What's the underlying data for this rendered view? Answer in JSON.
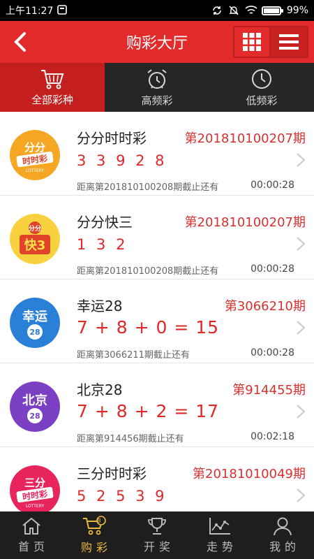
{
  "status_bar": {
    "time": "上午11:27",
    "battery": "99%",
    "battery_level": 0.99
  },
  "header": {
    "title": "购彩大厅",
    "icons": [
      "back-icon",
      "grid-icon",
      "menu-icon"
    ]
  },
  "tabs": [
    {
      "label": "全部彩种",
      "icon": "basket-icon",
      "active": true
    },
    {
      "label": "高频彩",
      "icon": "alarm-clock-icon",
      "active": false
    },
    {
      "label": "低频彩",
      "icon": "clock-icon",
      "active": false
    }
  ],
  "lotteries": [
    {
      "name": "分分时时彩",
      "period": "第201810100207期",
      "numbers": "3 3 9 2 8",
      "deadline": "距离第201810100208期截止还有",
      "countdown": "00:00:28",
      "logo": {
        "line1": "分分",
        "line2": "时时彩",
        "sub": "LOTTERY",
        "color": "#f5a623"
      }
    },
    {
      "name": "分分快三",
      "period": "第201810100207期",
      "numbers": "1 3 2",
      "deadline": "距离第201810100208期截止还有",
      "countdown": "00:00:28",
      "logo": {
        "line1": "分分",
        "line2": "快3",
        "color": "#f7d23e"
      }
    },
    {
      "name": "幸运28",
      "period": "第3066210期",
      "numbers": "7 + 8 + 0 = 15",
      "deadline": "距离第3066211期截止还有",
      "countdown": "00:00:28",
      "logo": {
        "line1": "幸运",
        "line2": "28",
        "color": "#2a7fd6"
      }
    },
    {
      "name": "北京28",
      "period": "第914455期",
      "numbers": "7 + 8 + 2 = 17",
      "deadline": "距离第914456期截止还有",
      "countdown": "00:02:18",
      "logo": {
        "line1": "北京",
        "line2": "28",
        "color": "#7b3fc4"
      }
    },
    {
      "name": "三分时时彩",
      "period": "第20181010049期",
      "numbers": "5 2 5 3 9",
      "logo": {
        "line1": "三分",
        "line2": "时时彩",
        "sub": "LOTTERY",
        "color": "#e8245c"
      }
    }
  ],
  "bottom_nav": [
    {
      "label": "首页",
      "icon": "home-icon",
      "active": false
    },
    {
      "label": "购彩",
      "icon": "cart-icon",
      "active": true
    },
    {
      "label": "开奖",
      "icon": "trophy-icon",
      "active": false
    },
    {
      "label": "走势",
      "icon": "trend-icon",
      "active": false
    },
    {
      "label": "我的",
      "icon": "user-icon",
      "active": false
    }
  ],
  "colors": {
    "primary_red": "#e32b2b",
    "tab_active": "#c41e1e",
    "number_red": "#e02828",
    "nav_active": "#e9b93c"
  }
}
